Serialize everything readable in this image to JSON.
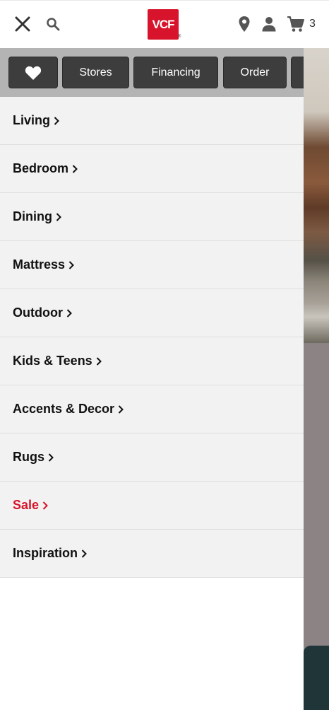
{
  "header": {
    "logo_text": "VCF",
    "logo_reg": "®",
    "cart_count": "3",
    "icons": [
      "close-icon",
      "search-icon",
      "location-pin-icon",
      "user-icon",
      "cart-icon"
    ]
  },
  "quick_links": [
    {
      "icon": "heart-icon",
      "label": ""
    },
    {
      "label": "Stores"
    },
    {
      "label": "Financing"
    },
    {
      "label": "Order"
    }
  ],
  "menu": {
    "items": [
      {
        "label": "Living"
      },
      {
        "label": "Bedroom"
      },
      {
        "label": "Dining"
      },
      {
        "label": "Mattress"
      },
      {
        "label": "Outdoor"
      },
      {
        "label": "Kids & Teens"
      },
      {
        "label": "Accents & Decor"
      },
      {
        "label": "Rugs"
      },
      {
        "label": "Sale"
      },
      {
        "label": "Inspiration"
      }
    ]
  },
  "colors": {
    "brand_red": "#d7142b",
    "button_dark": "#3d3d3d",
    "bar_gray": "#b4b4b4",
    "menu_bg": "#f2f2f2"
  }
}
